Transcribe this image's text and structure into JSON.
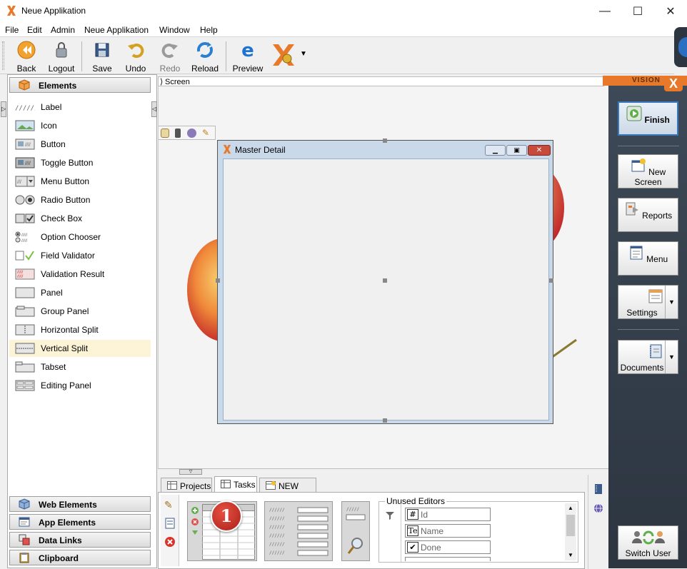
{
  "window": {
    "title": "Neue Applikation",
    "minimize": "—",
    "maximize": "☐",
    "close": "✕"
  },
  "menu": [
    "File",
    "Edit",
    "Admin",
    "Neue Applikation",
    "Window",
    "Help"
  ],
  "toolbar": {
    "back": "Back",
    "logout": "Logout",
    "save": "Save",
    "undo": "Undo",
    "redo": "Redo",
    "reload": "Reload",
    "preview": "Preview"
  },
  "left_panel": {
    "elements_header": "Elements",
    "items": [
      "Label",
      "Icon",
      "Button",
      "Toggle Button",
      "Menu Button",
      "Radio Button",
      "Check Box",
      "Option Chooser",
      "Field Validator",
      "Validation Result",
      "Panel",
      "Group Panel",
      "Horizontal Split",
      "Vertical Split",
      "Tabset",
      "Editing Panel"
    ],
    "selected_item": "Vertical Split",
    "sections": [
      "Web Elements",
      "App Elements",
      "Data Links",
      "Clipboard"
    ]
  },
  "screen_breadcrumb": "Screen",
  "designer": {
    "window_title": "Master Detail"
  },
  "vision": {
    "brand": "VISION",
    "finish": "Finish",
    "new_screen": "New Screen",
    "reports": "Reports",
    "menu": "Menu",
    "settings": "Settings",
    "documents": "Documents",
    "switch_user": "Switch User"
  },
  "bottom": {
    "tabs": [
      "Projects",
      "Tasks",
      "NEW table"
    ],
    "active_tab": "Tasks",
    "step_badge": "1",
    "unused_editors_label": "Unused Editors",
    "editors": [
      {
        "icon": "#",
        "name": "Id"
      },
      {
        "icon": "Te",
        "name": "Name"
      },
      {
        "icon": "✔",
        "name": "Done"
      }
    ]
  },
  "colors": {
    "accent": "#e8792a",
    "vision_bg": "#34404d",
    "selected_bg": "#fdf4d7"
  }
}
